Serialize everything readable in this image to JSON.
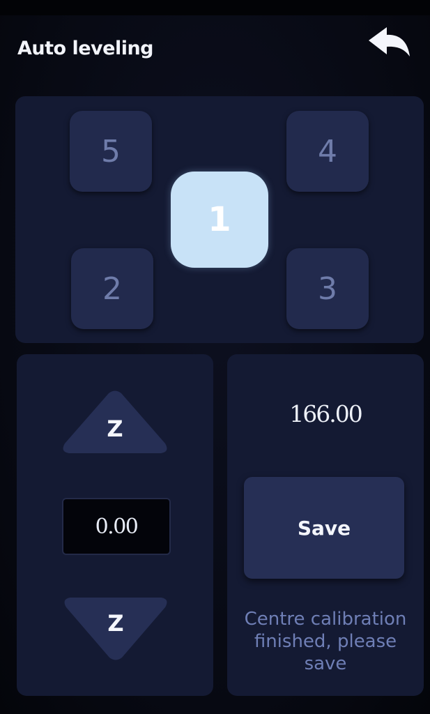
{
  "header": {
    "title": "Auto leveling",
    "back_icon": "back-arrow-icon"
  },
  "points": {
    "active": "1",
    "items": [
      {
        "label": "5"
      },
      {
        "label": "4"
      },
      {
        "label": "1"
      },
      {
        "label": "2"
      },
      {
        "label": "3"
      }
    ]
  },
  "z_control": {
    "up_label": "Z",
    "down_label": "Z",
    "offset_value": "0.00",
    "up_icon": "triangle-up-icon",
    "down_icon": "triangle-down-icon"
  },
  "save_panel": {
    "measurement": "166.00",
    "save_label": "Save",
    "status_message": "Centre calibration finished, please save"
  },
  "colors": {
    "background": "#070912",
    "panel": "#141a33",
    "button": "#222a4d",
    "active_button": "#c8e2f7",
    "text": "#f2f4fa",
    "muted_text": "#6f7caa",
    "status_text": "#6f7fb6"
  }
}
